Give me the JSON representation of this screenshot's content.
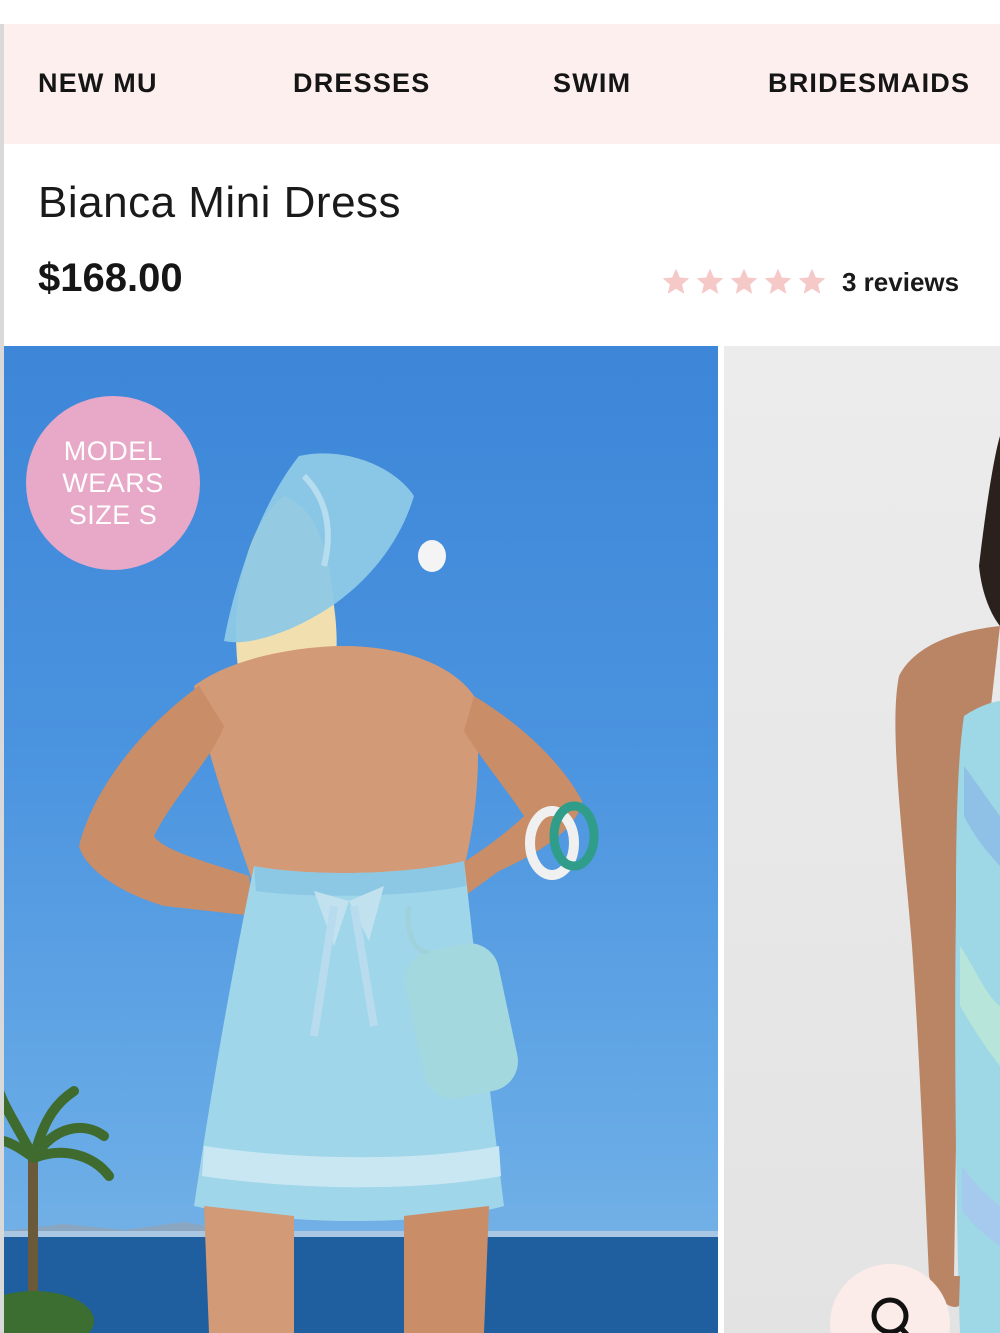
{
  "nav": {
    "items": [
      {
        "label": "NEW MU"
      },
      {
        "label": "DRESSES"
      },
      {
        "label": "SWIM"
      },
      {
        "label": "BRIDESMAIDS"
      }
    ]
  },
  "product": {
    "title": "Bianca Mini Dress",
    "price": "$168.00",
    "rating": {
      "stars": 5,
      "star_color": "#f6c9c9",
      "reviews_label": "3 reviews"
    }
  },
  "gallery": {
    "badge": {
      "line1": "MODEL",
      "line2": "WEARS",
      "line3": "SIZE S",
      "color": "#e8a8c7"
    },
    "zoom_icon": "search-icon"
  },
  "colors": {
    "nav_background": "#fcefee",
    "sky": "#4a93df"
  }
}
